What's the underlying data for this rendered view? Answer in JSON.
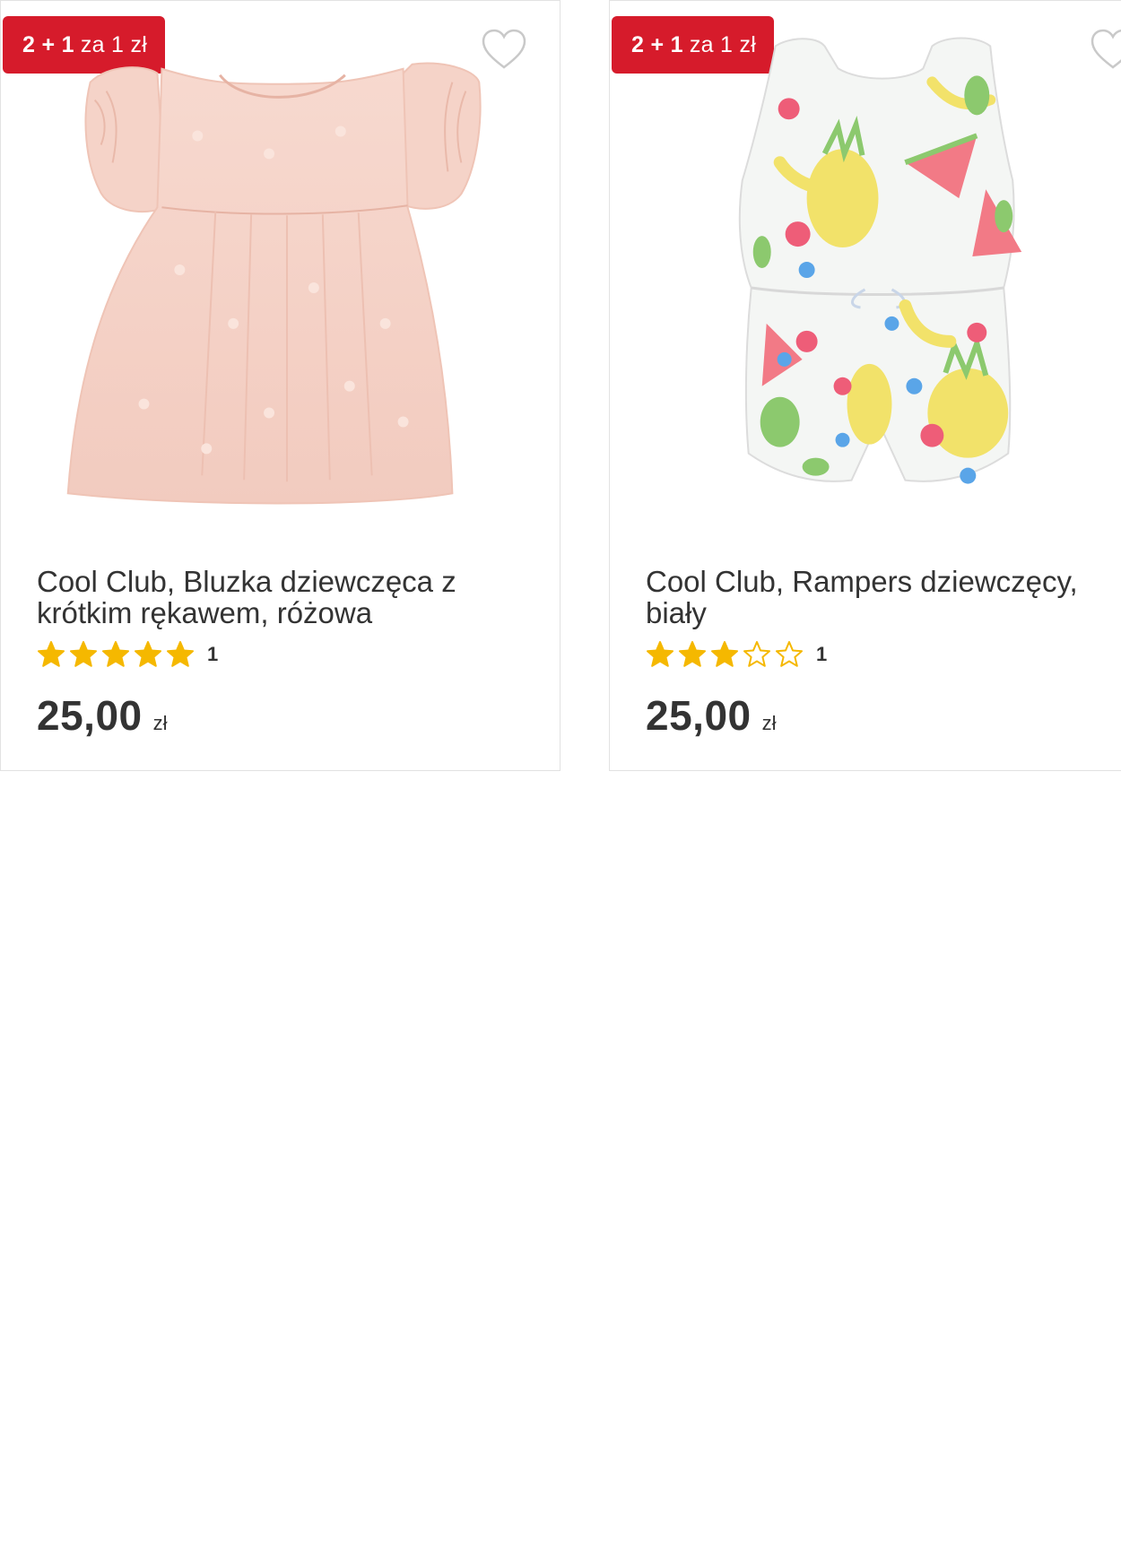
{
  "colors": {
    "badge": "#d61b2b",
    "star": "#f5b800",
    "text": "#333333",
    "border": "#e2e2e2"
  },
  "products": [
    {
      "badge_bold": "2 + 1",
      "badge_rest": "za 1 zł",
      "title": "Cool Club, Bluzka dziewczęca z krótkim rękawem, różowa",
      "rating": 5,
      "rating_max": 5,
      "review_count": "1",
      "price": "25,00",
      "currency": "zł",
      "favorite_icon": "heart-outline-icon"
    },
    {
      "badge_bold": "2 + 1",
      "badge_rest": "za 1 zł",
      "title": "Cool Club, Rampers dziewczęcy, biały",
      "rating": 3,
      "rating_max": 5,
      "review_count": "1",
      "price": "25,00",
      "currency": "zł",
      "favorite_icon": "heart-outline-icon"
    }
  ]
}
